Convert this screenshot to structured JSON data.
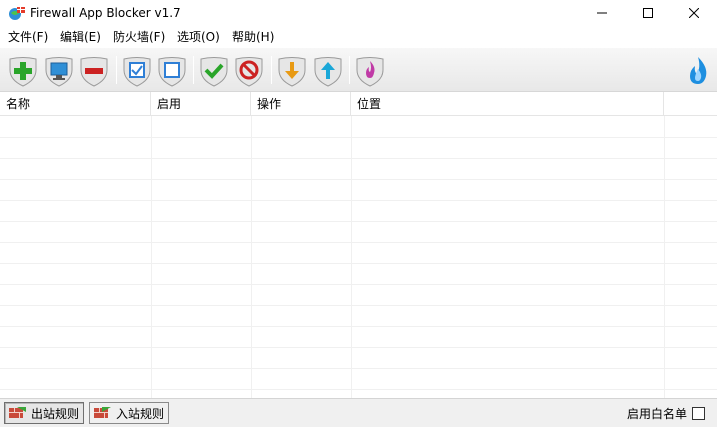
{
  "window": {
    "title": "Firewall App Blocker v1.7",
    "controls": {
      "minimize": "minimize",
      "maximize": "maximize",
      "close": "close"
    }
  },
  "menu": {
    "items": [
      {
        "label": "文件(F)"
      },
      {
        "label": "编辑(E)"
      },
      {
        "label": "防火墙(F)"
      },
      {
        "label": "选项(O)"
      },
      {
        "label": "帮助(H)"
      }
    ]
  },
  "toolbar": {
    "buttons": [
      {
        "icon": "add-icon",
        "color": "#2aa52a"
      },
      {
        "icon": "monitor-icon",
        "color": "#2f8fd6"
      },
      {
        "icon": "remove-icon",
        "color": "#cc2222"
      },
      {
        "icon": "check-square-icon",
        "color": "#2f7fd6"
      },
      {
        "icon": "square-icon",
        "color": "#2f7fd6"
      },
      {
        "icon": "enable-check-icon",
        "color": "#2aa52a"
      },
      {
        "icon": "block-icon",
        "color": "#cc2222"
      },
      {
        "icon": "move-down-icon",
        "color": "#e89a14"
      },
      {
        "icon": "move-up-icon",
        "color": "#1aa7d8"
      },
      {
        "icon": "flame-icon",
        "color": "#c03aa6"
      }
    ],
    "right_icon": {
      "icon": "water-flame-icon",
      "color": "#1e8fe0"
    }
  },
  "table": {
    "columns": [
      {
        "label": "名称"
      },
      {
        "label": "启用"
      },
      {
        "label": "操作"
      },
      {
        "label": "位置"
      }
    ],
    "rows": []
  },
  "bottom": {
    "tabs": [
      {
        "label": "出站规则",
        "active": true
      },
      {
        "label": "入站规则",
        "active": false
      }
    ],
    "whitelist_label": "启用白名单",
    "whitelist_checked": false
  }
}
